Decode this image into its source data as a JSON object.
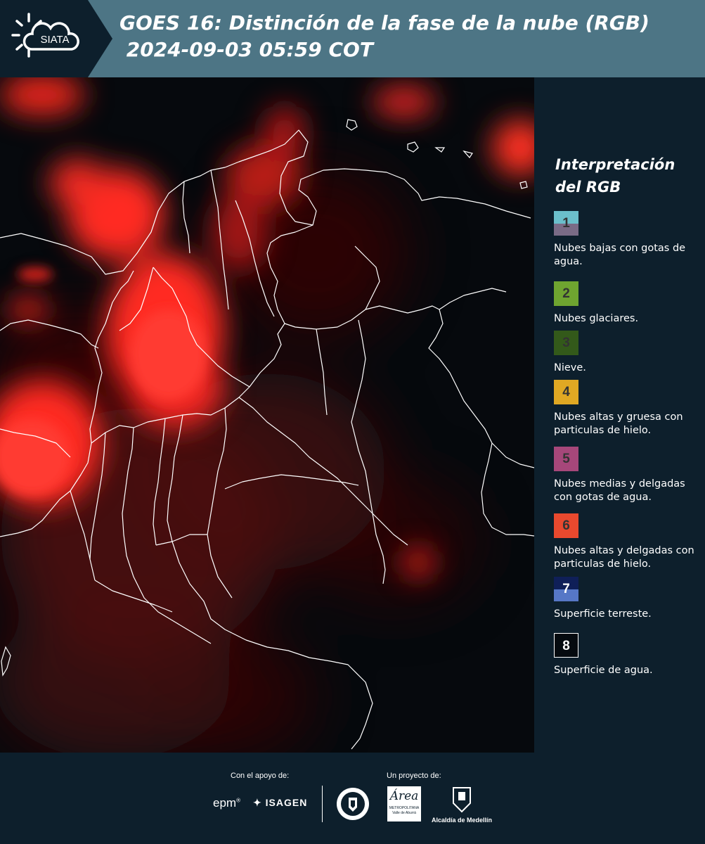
{
  "header": {
    "logo_text": "SIATA",
    "title": "GOES 16: Distinción de la fase de la nube (RGB)\n 2024-09-03 05:59 COT"
  },
  "legend": {
    "title": "Interpretación\ndel RGB",
    "items": [
      {
        "number": "1",
        "label": "Nubes bajas con gotas de agua.",
        "top_color": "#6bbfcb",
        "bottom_color": "#7a6b86"
      },
      {
        "number": "2",
        "label": "Nubes glaciares.",
        "top_color": "#6fa430",
        "bottom_color": "#6fa430"
      },
      {
        "number": "3",
        "label": "Nieve.",
        "top_color": "#33591a",
        "bottom_color": "#33591a"
      },
      {
        "number": "4",
        "label": "Nubes altas y gruesa con particulas de hielo.",
        "top_color": "#e0a823",
        "bottom_color": "#e0a823"
      },
      {
        "number": "5",
        "label": "Nubes medias y delgadas con gotas de agua.",
        "top_color": "#a6477a",
        "bottom_color": "#a6477a"
      },
      {
        "number": "6",
        "label": "Nubes altas y delgadas con particulas de hielo.",
        "top_color": "#e9492e",
        "bottom_color": "#e9492e"
      },
      {
        "number": "7",
        "label": "Superficie terreste.",
        "top_color": "#0f1f58",
        "bottom_color": "#5677c6"
      },
      {
        "number": "8",
        "label": "Superficie de agua.",
        "top_color": "#050a0f",
        "bottom_color": "#050a0f"
      }
    ]
  },
  "footer": {
    "support_label": "Con el apoyo de:",
    "project_label": "Un proyecto de:",
    "epm_text": "epm",
    "isagen_text": "ISAGEN",
    "area_text": "Área",
    "area_sub": "METROPOLITANA",
    "area_sub2": "Valle de Aburrá",
    "alcaldia_text": "Alcaldía de Medellín"
  }
}
